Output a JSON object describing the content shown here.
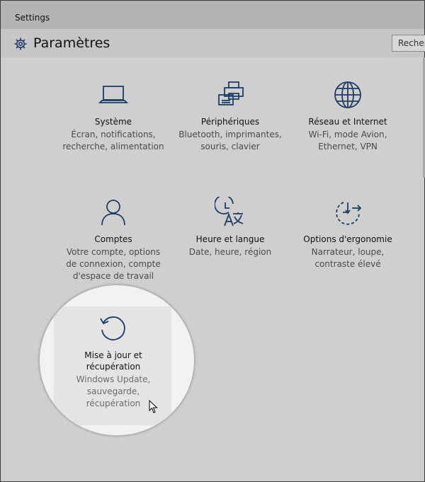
{
  "window": {
    "title": "Settings"
  },
  "header": {
    "title": "Paramètres",
    "icon": "gear-icon",
    "search_placeholder": "Recher"
  },
  "tiles": [
    {
      "title": "Système",
      "desc": [
        "Écran, notifications,",
        "recherche, alimentation"
      ],
      "icon": "laptop-icon"
    },
    {
      "title": "Périphériques",
      "desc": [
        "Bluetooth, imprimantes,",
        "souris, clavier"
      ],
      "icon": "devices-icon"
    },
    {
      "title": "Réseau et Internet",
      "desc": [
        "Wi-Fi, mode Avion,",
        "Ethernet, VPN"
      ],
      "icon": "globe-icon"
    },
    {
      "title": "Comptes",
      "desc": [
        "Votre compte, options",
        "de connexion, compte",
        "d'espace de travail"
      ],
      "icon": "person-icon"
    },
    {
      "title": "Heure et langue",
      "desc": [
        "Date, heure, région"
      ],
      "icon": "time-language-icon"
    },
    {
      "title": "Options d'ergonomie",
      "desc": [
        "Narrateur, loupe,",
        "contraste élevé"
      ],
      "icon": "ease-of-access-icon"
    },
    {
      "title": [
        "Mise à jour et",
        "récupération"
      ],
      "desc": [
        "Windows Update,",
        "sauvegarde,",
        "récupération"
      ],
      "icon": "refresh-icon"
    }
  ],
  "colors": {
    "background": "#cfcfcf",
    "titlebar": "#b4b4b4",
    "icon": "#1e3c66",
    "magnifier": "#f2f2f2"
  }
}
